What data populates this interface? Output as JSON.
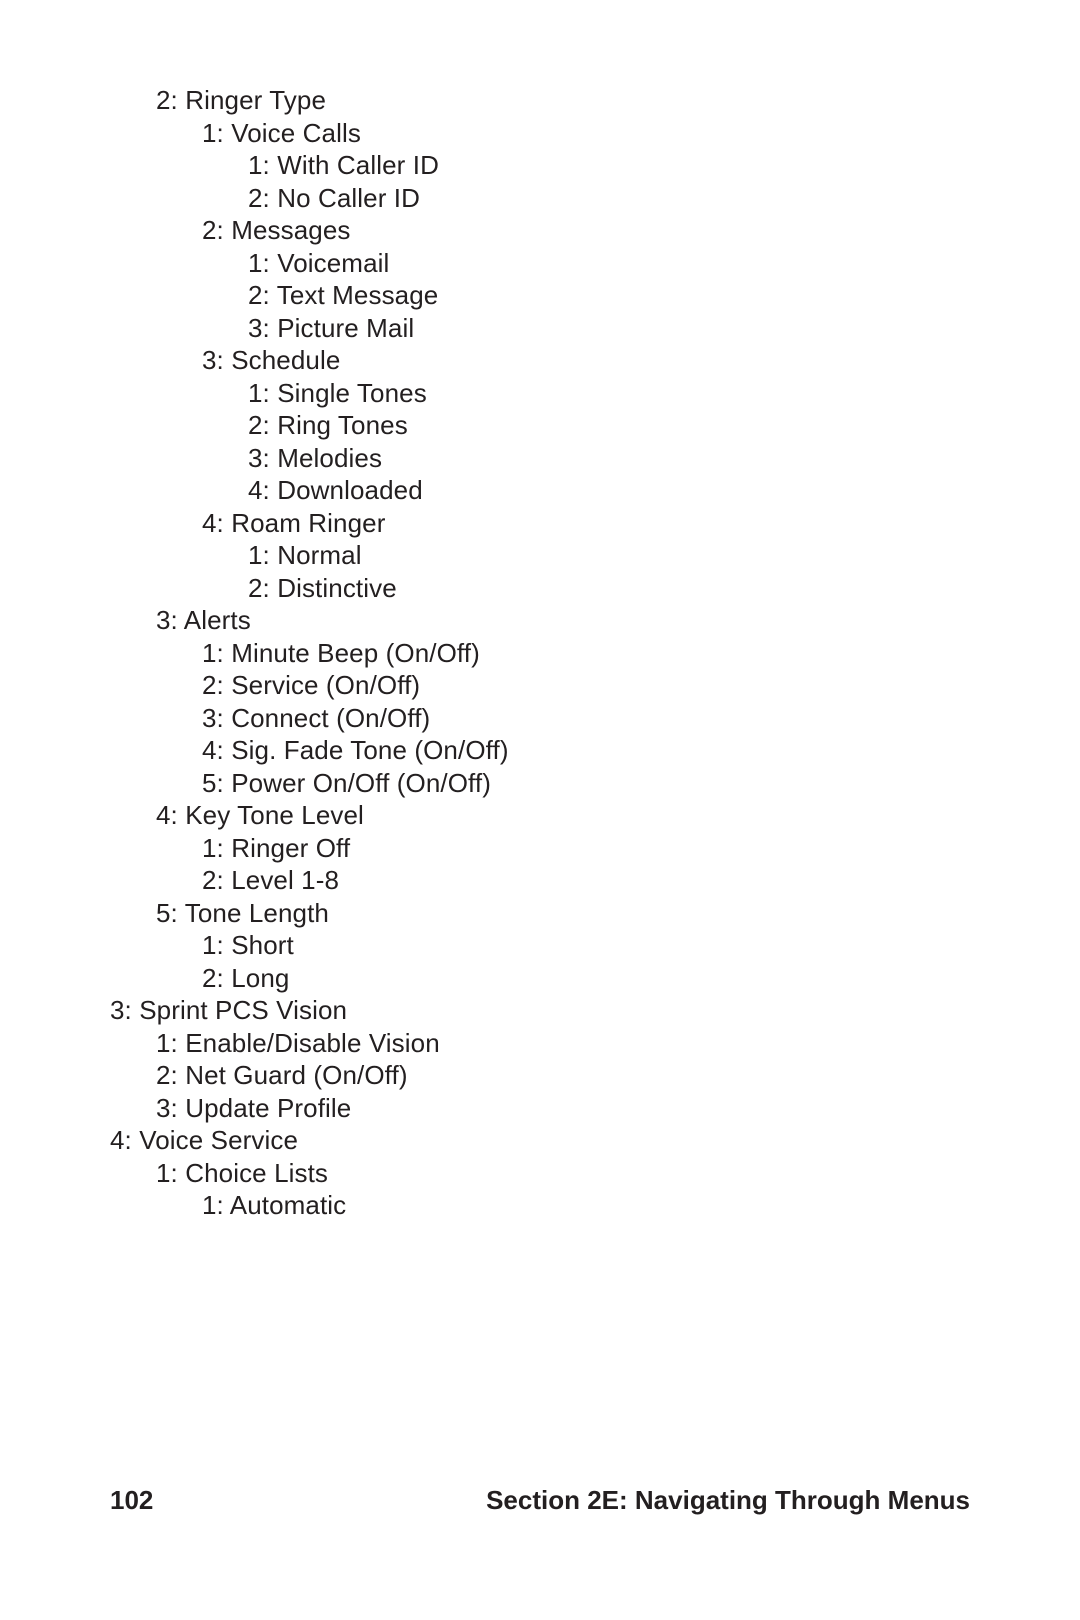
{
  "footer": {
    "page_number": "102",
    "section_title": "Section 2E: Navigating Through Menus"
  },
  "lines": [
    {
      "indent": 2,
      "text": "2: Ringer Type"
    },
    {
      "indent": 3,
      "text": "1: Voice Calls"
    },
    {
      "indent": 4,
      "text": "1: With Caller ID"
    },
    {
      "indent": 4,
      "text": "2: No Caller ID"
    },
    {
      "indent": 3,
      "text": "2: Messages"
    },
    {
      "indent": 4,
      "text": "1: Voicemail"
    },
    {
      "indent": 4,
      "text": "2: Text Message"
    },
    {
      "indent": 4,
      "text": "3: Picture Mail"
    },
    {
      "indent": 3,
      "text": "3: Schedule"
    },
    {
      "indent": 4,
      "text": "1: Single Tones"
    },
    {
      "indent": 4,
      "text": "2: Ring Tones"
    },
    {
      "indent": 4,
      "text": "3: Melodies"
    },
    {
      "indent": 4,
      "text": "4: Downloaded"
    },
    {
      "indent": 3,
      "text": "4: Roam Ringer"
    },
    {
      "indent": 4,
      "text": "1: Normal"
    },
    {
      "indent": 4,
      "text": "2: Distinctive"
    },
    {
      "indent": 2,
      "text": "3: Alerts"
    },
    {
      "indent": 3,
      "text": "1: Minute Beep (On/Off)"
    },
    {
      "indent": 3,
      "text": "2: Service (On/Off)"
    },
    {
      "indent": 3,
      "text": "3: Connect (On/Off)"
    },
    {
      "indent": 3,
      "text": "4: Sig. Fade Tone (On/Off)"
    },
    {
      "indent": 3,
      "text": "5: Power On/Off (On/Off)"
    },
    {
      "indent": 2,
      "text": "4: Key Tone Level"
    },
    {
      "indent": 3,
      "text": "1: Ringer Off"
    },
    {
      "indent": 3,
      "text": "2: Level 1-8"
    },
    {
      "indent": 2,
      "text": "5: Tone Length"
    },
    {
      "indent": 3,
      "text": "1: Short"
    },
    {
      "indent": 3,
      "text": "2: Long"
    },
    {
      "indent": 1,
      "text": "3: Sprint PCS Vision"
    },
    {
      "indent": 2,
      "text": "1: Enable/Disable Vision"
    },
    {
      "indent": 2,
      "text": "2: Net Guard (On/Off)"
    },
    {
      "indent": 2,
      "text": "3: Update Profile"
    },
    {
      "indent": 1,
      "text": "4: Voice Service"
    },
    {
      "indent": 2,
      "text": "1: Choice Lists"
    },
    {
      "indent": 3,
      "text": "1: Automatic"
    }
  ]
}
